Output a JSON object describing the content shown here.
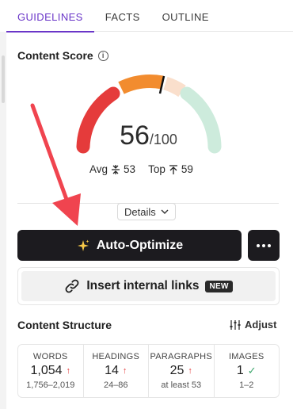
{
  "tabs": [
    {
      "label": "GUIDELINES"
    },
    {
      "label": "FACTS"
    },
    {
      "label": "OUTLINE"
    }
  ],
  "content_score": {
    "title": "Content Score",
    "info_symbol": "i",
    "score": "56",
    "max": "/100",
    "avg_label": "Avg",
    "avg_value": "53",
    "top_label": "Top",
    "top_value": "59",
    "gauge_colors": [
      "#e53b3b",
      "#f28c2f",
      "#fadfcc",
      "#cdebdc"
    ]
  },
  "details_label": "Details",
  "actions": {
    "auto_optimize_label": "Auto-Optimize",
    "auto_optimize_icon": "sparkle-icon",
    "insert_links_label": "Insert internal links",
    "new_badge": "NEW"
  },
  "structure": {
    "title": "Content Structure",
    "adjust_label": "Adjust",
    "cells": [
      {
        "label": "WORDS",
        "value": "1,054",
        "trend": "up",
        "range": "1,756–2,019"
      },
      {
        "label": "HEADINGS",
        "value": "14",
        "trend": "up",
        "range": "24–86"
      },
      {
        "label": "PARAGRAPHS",
        "value": "25",
        "trend": "up",
        "range": "at least 53"
      },
      {
        "label": "IMAGES",
        "value": "1",
        "trend": "ok",
        "range": "1–2"
      }
    ]
  },
  "annotation": {
    "color": "#f0444f"
  }
}
